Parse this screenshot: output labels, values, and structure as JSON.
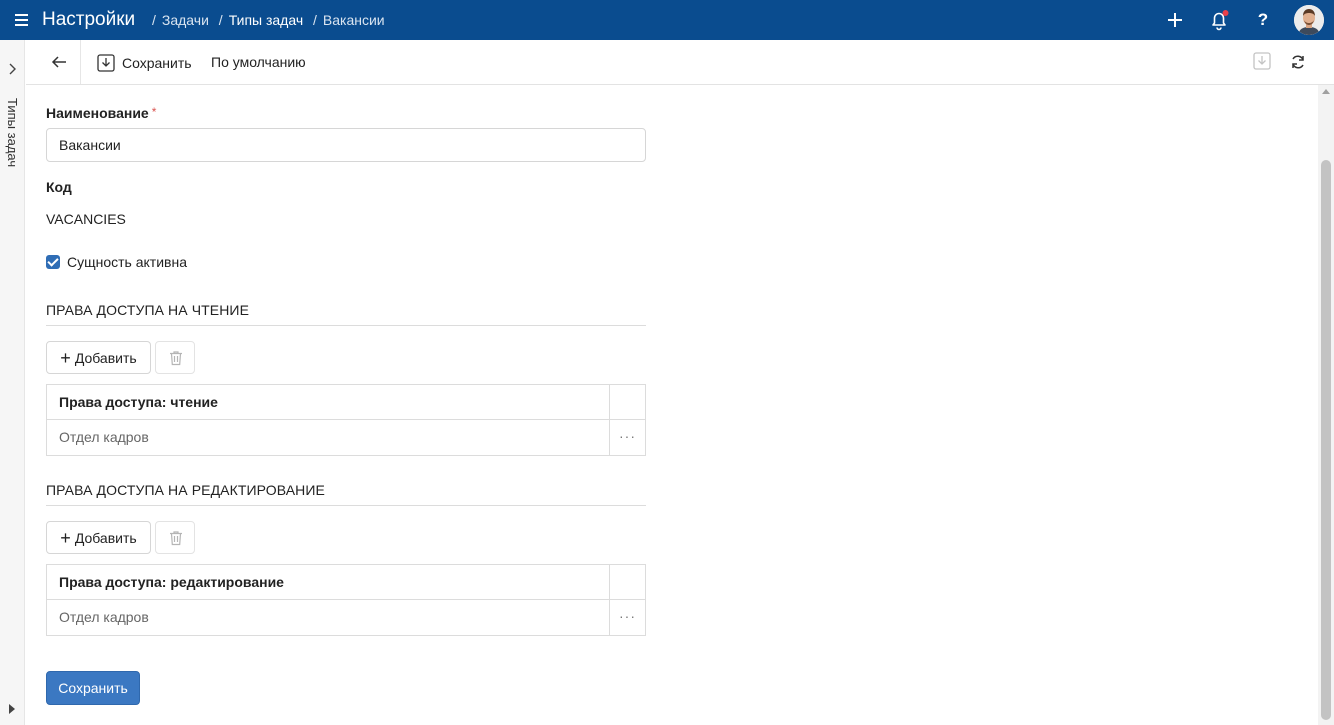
{
  "header": {
    "app_title": "Настройки",
    "breadcrumbs": [
      {
        "label": "Задачи"
      },
      {
        "label": "Типы задач"
      },
      {
        "label": "Вакансии"
      }
    ],
    "separator": "/",
    "help_label": "?",
    "bell_badge_color": "#e8404a",
    "bar_color": "#0a4c8f"
  },
  "sidebar": {
    "label": "Типы задач"
  },
  "toolbar": {
    "save_label": "Сохранить",
    "default_label": "По умолчанию"
  },
  "form": {
    "name_label": "Наименование",
    "required_mark": "*",
    "name_value": "Вакансии",
    "code_label": "Код",
    "code_value": "VACANCIES",
    "active_label": "Сущность активна",
    "active_checked": true
  },
  "read_section": {
    "title": "ПРАВА ДОСТУПА НА ЧТЕНИЕ",
    "add_label": "Добавить",
    "column_header": "Права доступа: чтение",
    "rows": [
      "Отдел кадров"
    ],
    "row_menu": "···"
  },
  "edit_section": {
    "title": "ПРАВА ДОСТУПА НА РЕДАКТИРОВАНИЕ",
    "add_label": "Добавить",
    "column_header": "Права доступа: редактирование",
    "rows": [
      "Отдел кадров"
    ],
    "row_menu": "···"
  },
  "footer": {
    "save_label": "Сохранить"
  }
}
